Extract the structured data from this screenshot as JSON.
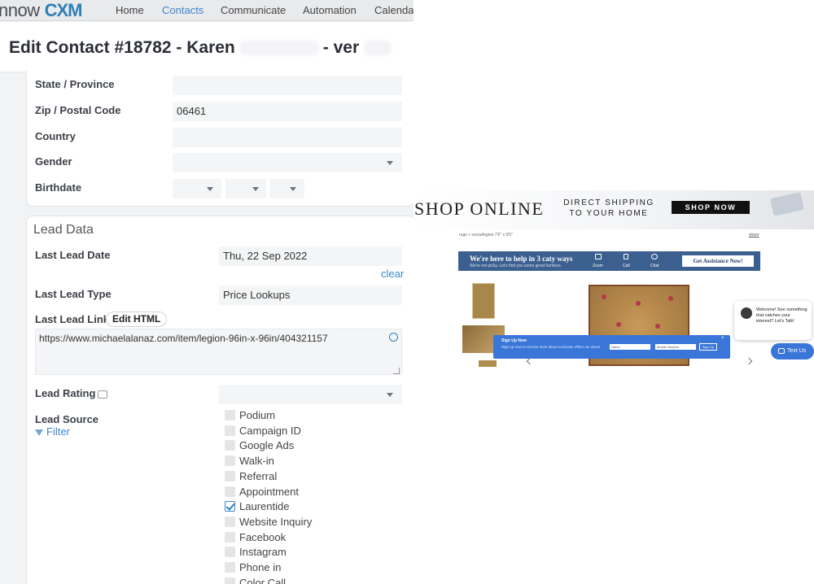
{
  "crm": {
    "logo": {
      "prefix": "nnow",
      "brand": "CXM"
    },
    "nav": [
      "Home",
      "Contacts",
      "Communicate",
      "Automation",
      "Calendar"
    ],
    "active_nav": "Contacts",
    "title_prefix": "Edit Contact #18782 - Karen",
    "title_suffix": "- ver",
    "contact_fields": {
      "state_label": "State / Province",
      "state_value": "",
      "zip_label": "Zip / Postal Code",
      "zip_value": "06461",
      "country_label": "Country",
      "country_value": "",
      "gender_label": "Gender",
      "gender_value": "",
      "birthdate_label": "Birthdate"
    },
    "lead": {
      "section_title": "Lead Data",
      "last_date_label": "Last Lead Date",
      "last_date_value": "Thu, 22 Sep 2022",
      "clear": "clear",
      "last_type_label": "Last Lead Type",
      "last_type_value": "Price Lookups",
      "last_link_label": "Last Lead Link",
      "edit_html": "Edit HTML",
      "last_link_value": "https://www.michaelalanaz.com/item/legion-96in-x-96in/404321157",
      "rating_label": "Lead Rating",
      "source_label": "Lead Source",
      "filter": "Filter",
      "sources": [
        {
          "label": "Podium",
          "checked": false
        },
        {
          "label": "Campaign ID",
          "checked": false
        },
        {
          "label": "Google Ads",
          "checked": false
        },
        {
          "label": "Walk-in",
          "checked": false
        },
        {
          "label": "Referral",
          "checked": false
        },
        {
          "label": "Appointment",
          "checked": false
        },
        {
          "label": "Laurentide",
          "checked": true
        },
        {
          "label": "Website Inquiry",
          "checked": false
        },
        {
          "label": "Facebook",
          "checked": false
        },
        {
          "label": "Instagram",
          "checked": false
        },
        {
          "label": "Phone in",
          "checked": false
        },
        {
          "label": "Color Call",
          "checked": false
        }
      ]
    }
  },
  "shop": {
    "banner": {
      "shop_online": "SHOP ONLINE",
      "direct": "DIRECT SHIPPING",
      "to_home": "TO YOUR HOME",
      "shop_now": "SHOP NOW"
    },
    "breadcrumb": "rugs > surya/legion 7'6\" x 9'6\"",
    "share": "share",
    "help": {
      "title": "We're here to help in 3 caty ways",
      "subtitle": "We're not picky. Let's find you some great furniture.",
      "options": [
        "Zoom",
        "Call",
        "Chat"
      ],
      "cta": "Get Assistance Now!"
    },
    "signup": {
      "title": "Sign Up Now",
      "text": "Sign up now to receive texts about exclusive offers our doors",
      "name_placeholder": "Name",
      "mobile_placeholder": "Mobile Number",
      "button": "Sign Up",
      "close": "×"
    },
    "chat": {
      "message": "Welcome! See something that catches your interest? Let's Talk!",
      "text_us": "Text Us"
    }
  }
}
